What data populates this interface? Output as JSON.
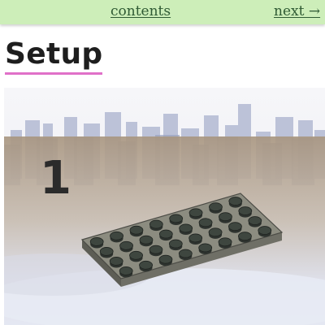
{
  "nav": {
    "contents_label": "contents",
    "next_label": "next →"
  },
  "page": {
    "title": "Setup"
  },
  "illustration": {
    "step_number": "1",
    "subject": "gray baseplate with studs over a city skyline background",
    "colors": {
      "plate": "#8a8a7c",
      "stud": "#3e463f",
      "sky": "#f1f1f6",
      "city": "#a9b1c9",
      "ground": "#b5a593",
      "accent_underline": "#e070c8",
      "nav_bg": "#cdeeb9"
    }
  }
}
